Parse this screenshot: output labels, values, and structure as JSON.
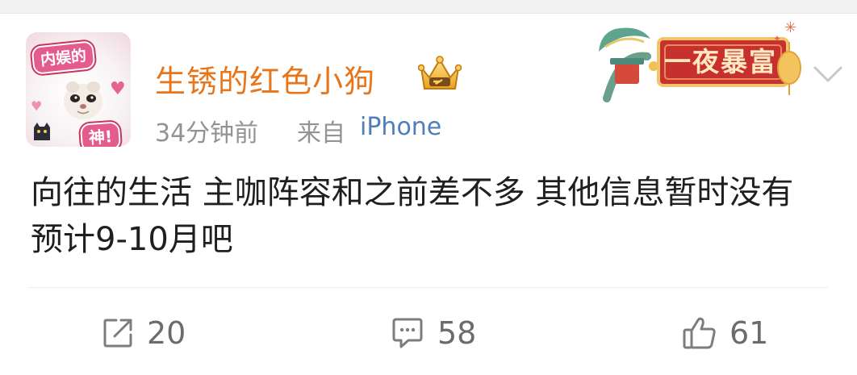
{
  "post": {
    "author": {
      "name": "生锈的红色小狗",
      "avatar_text_top": "内娱的",
      "avatar_text_bottom": "神!",
      "badge_icon": "vip-crown-icon"
    },
    "meta": {
      "time": "34分钟前",
      "source_prefix": "来自",
      "source": "iPhone"
    },
    "card_badge": {
      "label": "一夜暴富"
    },
    "text": "向往的生活 主咖阵容和之前差不多 其他信息暂时没有 预计9-10月吧",
    "actions": {
      "share_count": "20",
      "comment_count": "58",
      "like_count": "61"
    }
  },
  "colors": {
    "username": "#e8751a",
    "meta": "#939393",
    "link": "#4f7fb8",
    "text": "#1f1f1f",
    "action": "#777777"
  }
}
